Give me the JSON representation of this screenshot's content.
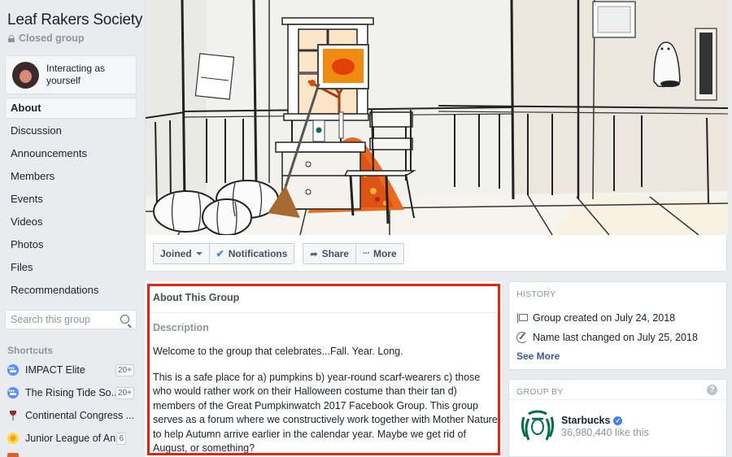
{
  "group": {
    "title": "Leaf Rakers Society",
    "privacy": "Closed group"
  },
  "interacting": {
    "text_line1": "Interacting as",
    "text_line2": "yourself"
  },
  "nav": {
    "items": [
      {
        "label": "About",
        "active": true
      },
      {
        "label": "Discussion"
      },
      {
        "label": "Announcements"
      },
      {
        "label": "Members"
      },
      {
        "label": "Events"
      },
      {
        "label": "Videos"
      },
      {
        "label": "Photos"
      },
      {
        "label": "Files"
      },
      {
        "label": "Recommendations"
      }
    ]
  },
  "search": {
    "placeholder": "Search this group",
    "value": ""
  },
  "shortcuts": {
    "label": "Shortcuts",
    "items": [
      {
        "name": "IMPACT Elite",
        "icon": "group-icon",
        "badge": "20+"
      },
      {
        "name": "The Rising Tide So...",
        "icon": "group-icon",
        "badge": "20+"
      },
      {
        "name": "Continental Congress ...",
        "icon": "wine-glass-icon",
        "badge": ""
      },
      {
        "name": "Junior League of An...",
        "icon": "flower-icon",
        "badge": "6"
      }
    ]
  },
  "cover": {
    "description": "Illustrated fall room scene with leaf pile, pumpkins, window, broom and ghost"
  },
  "actions": {
    "joined": "Joined",
    "notifications": "Notifications",
    "share": "Share",
    "more": "More"
  },
  "about": {
    "title": "About This Group",
    "description_label": "Description",
    "paragraphs": [
      "Welcome to the group that celebrates...Fall. Year. Long.",
      "This is a safe place for a) pumpkins b) year-round scarf-wearers c)  those who would rather work on their Halloween costume than their tan d) members of the Great Pumpkinwatch 2017 Facebook Group. This group serves as a forum where we constructively work together with Mother Nature to help Autumn arrive earlier in the calendar year. Maybe we get rid of August, or something?"
    ]
  },
  "history": {
    "label": "HISTORY",
    "created": "Group created on July 24, 2018",
    "name_changed": "Name last changed on July 25, 2018",
    "see_more": "See More"
  },
  "group_by": {
    "label": "GROUP BY",
    "help": "?",
    "name": "Starbucks",
    "verified": "✓",
    "likes": "36,980,440 like this"
  },
  "colors": {
    "highlight_frame": "#f01f0a",
    "link": "#385898",
    "accent": "#4080ff",
    "starbucks_green": "#00704a"
  }
}
